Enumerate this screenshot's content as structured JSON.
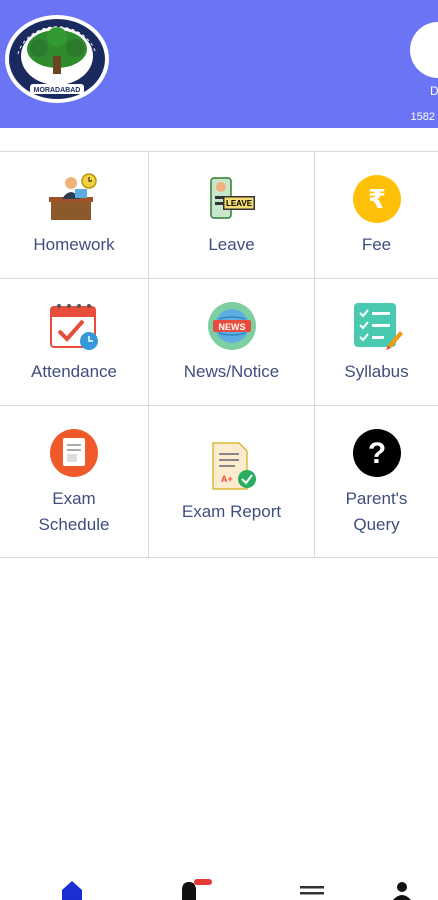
{
  "header": {
    "logo_icon": "school-emblem-logo",
    "profile_name": "D",
    "profile_id": "1582"
  },
  "grid": [
    {
      "label": "Homework",
      "icon": "teacher-desk-icon"
    },
    {
      "label": "Leave",
      "icon": "leave-letter-icon"
    },
    {
      "label": "Fee",
      "icon": "rupee-coin-icon"
    },
    {
      "label": "Attendance",
      "icon": "calendar-check-icon"
    },
    {
      "label": "News/Notice",
      "icon": "news-globe-icon"
    },
    {
      "label": "Syllabus",
      "icon": "checklist-pencil-icon"
    },
    {
      "label": "Exam\nSchedule",
      "icon": "exam-schedule-icon"
    },
    {
      "label": "Exam Report",
      "icon": "exam-report-icon"
    },
    {
      "label": "Parent's\nQuery",
      "icon": "question-mark-icon"
    }
  ],
  "bottom_nav": [
    {
      "name": "home",
      "icon": "home-icon",
      "active": true
    },
    {
      "name": "notifications",
      "icon": "bell-icon"
    },
    {
      "name": "menu",
      "icon": "menu-icon"
    },
    {
      "name": "profile",
      "icon": "person-icon"
    }
  ],
  "colors": {
    "header_bg": "#6a74f4",
    "label_text": "#3e4f7e",
    "active_nav": "#1a2fd1",
    "badge": "#e53935"
  }
}
